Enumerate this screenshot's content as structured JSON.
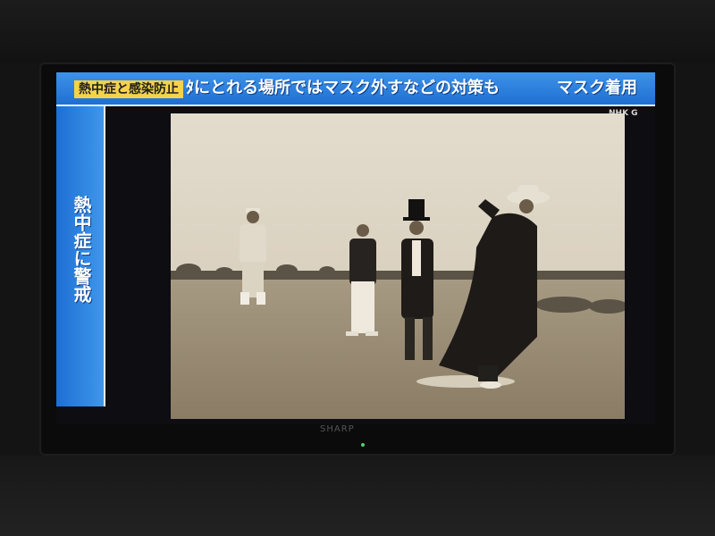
{
  "ticker": {
    "label": "熱中症と感染防止",
    "text": "ﾀにとれる場所ではマスク外すなどの対策も",
    "right": "マスク着用"
  },
  "side_panel": {
    "text": "熱中症に警戒"
  },
  "channel_logo": "NHK G",
  "tv_brand": "SHARP",
  "colors": {
    "ticker_blue": "#2f80dd",
    "label_yellow": "#f3d34a",
    "photo_sepia": "#d6cbb6"
  }
}
